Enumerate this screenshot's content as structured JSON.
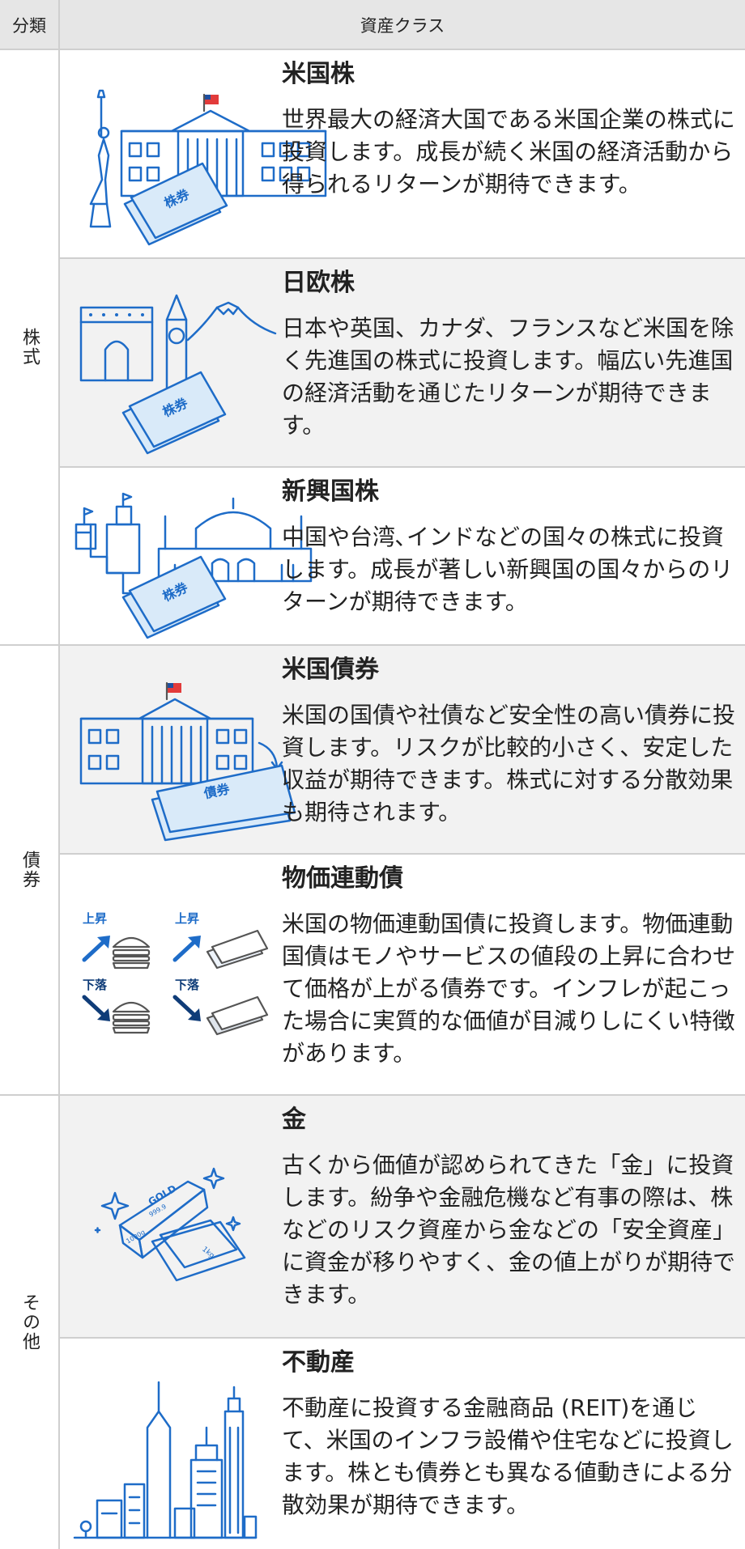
{
  "header": {
    "category": "分類",
    "asset_class": "資産クラス"
  },
  "categories": {
    "stocks": "株式",
    "bonds": "債券",
    "other": "その他"
  },
  "rows": [
    {
      "title": "米国株",
      "desc": "世界最大の経済大国である米国企業の株式に投資します。成長が続く米国の経済活動から得られるリターンが期待できます。",
      "icon": "us-stocks-illustration",
      "ticket_label": "株券"
    },
    {
      "title": "日欧株",
      "desc": "日本や英国、カナダ、フランスなど米国を除く先進国の株式に投資します。幅広い先進国の経済活動を通じたリターンが期待できます。",
      "icon": "developed-stocks-illustration",
      "ticket_label": "株券"
    },
    {
      "title": "新興国株",
      "desc": "中国や台湾､インドなどの国々の株式に投資します。成長が著しい新興国の国々からのリターンが期待できます。",
      "icon": "emerging-stocks-illustration",
      "ticket_label": "株券"
    },
    {
      "title": "米国債券",
      "desc": "米国の国債や社債など安全性の高い債券に投資します。リスクが比較的小さく、安定した収益が期待できます。株式に対する分散効果も期待されます。",
      "icon": "us-bonds-illustration",
      "ticket_label": "債券"
    },
    {
      "title": "物価連動債",
      "desc": "米国の物価連動国債に投資します。物価連動国債はモノやサービスの値段の上昇に合わせて価格が上がる債券です。インフレが起こった場合に実質的な価値が目減りしにくい特徴があります。",
      "icon": "inflation-bonds-illustration",
      "rise_label": "上昇",
      "fall_label": "下落"
    },
    {
      "title": "金",
      "desc": "古くから価値が認められてきた「金」に投資します。紛争や金融危機など有事の際は、株などのリスク資産から金などの「安全資産」に資金が移りやすく、金の値上がりが期待できます。",
      "icon": "gold-illustration",
      "bar_labels": [
        "GOLD",
        "999.9",
        "1000g",
        "1kg"
      ]
    },
    {
      "title": "不動産",
      "desc": "不動産に投資する金融商品 (REIT)を通じて、米国のインフラ設備や住宅などに投資します。株とも債券とも異なる値動きによる分散効果が期待できます。",
      "icon": "real-estate-illustration"
    }
  ],
  "colors": {
    "accent": "#1e6cc8",
    "shade": "#f2f2f2",
    "header": "#e6e6e6",
    "border": "#cfcfcf",
    "dark_arrow": "#0f3c78"
  }
}
